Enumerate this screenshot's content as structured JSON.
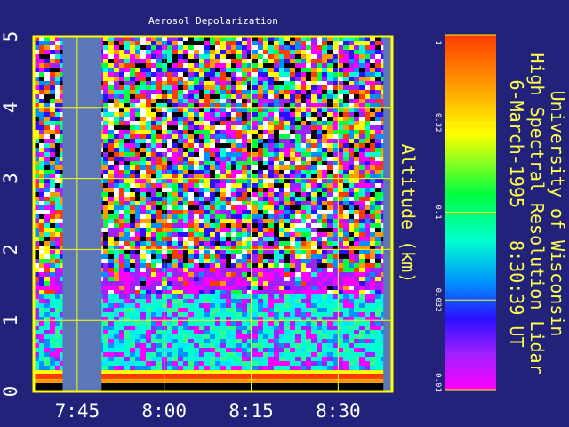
{
  "chart_data": {
    "type": "heatmap",
    "title": "Aerosol Depolarization",
    "ylabel": "Altitude (km)",
    "xlabel": "",
    "y_ticks": [
      "0",
      "1",
      "2",
      "3",
      "4",
      "5"
    ],
    "y_tick_values": [
      0,
      1,
      2,
      3,
      4,
      5
    ],
    "x_ticks": [
      "7:45",
      "8:00",
      "8:15",
      "8:30"
    ],
    "x_tick_values": [
      7.75,
      8.0,
      8.25,
      8.5
    ],
    "ylim": [
      0,
      5
    ],
    "xlim": [
      7.625,
      8.655
    ],
    "grid": true,
    "data_gaps": [
      {
        "start": 7.708,
        "end": 7.82
      },
      {
        "start": 8.63,
        "end": 8.655
      }
    ],
    "aerosol_layer_top_km": 1.4,
    "colorbar": {
      "scale": "log",
      "range": [
        0.01,
        1
      ],
      "tick_labels": [
        "1",
        "0.32",
        "0.1",
        "0.032",
        "0.01"
      ],
      "tick_values": [
        1,
        0.32,
        0.1,
        0.032,
        0.01
      ],
      "colormap": [
        "#ff3a00",
        "#ff9a00",
        "#ffff00",
        "#00ff40",
        "#00ffd0",
        "#0090ff",
        "#2a10ff",
        "#a020ff",
        "#ff00ff"
      ]
    }
  },
  "header": {
    "institution": "University of Wisconsin",
    "instrument": "High Spectral Resolution Lidar",
    "date_time": "6-March-1995   8:30:39 UT"
  },
  "colors": {
    "background": "#22227a",
    "frame": "#ffff00",
    "gap_fill": "#5a78b8",
    "text_yellow": "#ffff4d",
    "text_white": "#ffffff"
  }
}
